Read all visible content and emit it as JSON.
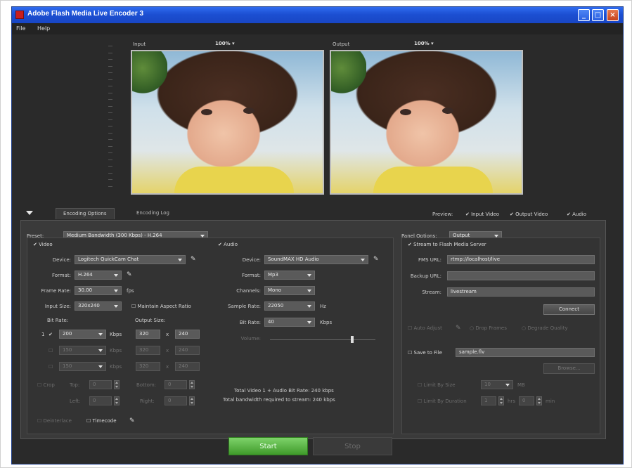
{
  "window": {
    "title": "Adobe Flash Media Live Encoder 3"
  },
  "menu": {
    "file": "File",
    "help": "Help"
  },
  "preview": {
    "input_label": "Input",
    "input_zoom": "100% ▾",
    "output_label": "Output",
    "output_zoom": "100% ▾"
  },
  "tabs": {
    "encoding_options": "Encoding Options",
    "encoding_log": "Encoding Log"
  },
  "preview_toggles": {
    "label": "Preview:",
    "input_video": "✔ Input Video",
    "output_video": "✔ Output Video",
    "audio": "✔ Audio"
  },
  "preset": {
    "label": "Preset:",
    "value": "Medium Bandwidth (300 Kbps) - H.264"
  },
  "video": {
    "header": "✔ Video",
    "device_label": "Device:",
    "device_value": "Logitech QuickCam Chat",
    "format_label": "Format:",
    "format_value": "H.264",
    "frame_rate_label": "Frame Rate:",
    "frame_rate_value": "30.00",
    "fps": "fps",
    "input_size_label": "Input Size:",
    "input_size_value": "320x240",
    "maintain_aspect": "☐ Maintain Aspect Ratio",
    "bit_rate_header": "Bit Rate:",
    "output_size_header": "Output Size:",
    "rows": [
      {
        "idx": "1",
        "check": "✔",
        "rate": "200",
        "unit": "Kbps",
        "w": "320",
        "h": "240",
        "dim": false
      },
      {
        "idx": "",
        "check": "☐",
        "rate": "150",
        "unit": "Kbps",
        "w": "320",
        "h": "240",
        "dim": true
      },
      {
        "idx": "",
        "check": "☐",
        "rate": "150",
        "unit": "Kbps",
        "w": "320",
        "h": "240",
        "dim": true
      }
    ],
    "x": "x",
    "crop": "☐ Crop",
    "top": "Top:",
    "bottom": "Bottom:",
    "left": "Left:",
    "right": "Right:",
    "crop_top": "0",
    "crop_bottom": "0",
    "crop_left": "0",
    "crop_right": "0",
    "deinterlace": "☐ Deinterlace",
    "timecode": "☐ Timecode"
  },
  "audio": {
    "header": "✔ Audio",
    "device_label": "Device:",
    "device_value": "SoundMAX HD Audio",
    "format_label": "Format:",
    "format_value": "Mp3",
    "channels_label": "Channels:",
    "channels_value": "Mono",
    "sample_rate_label": "Sample Rate:",
    "sample_rate_value": "22050",
    "hz": "Hz",
    "bit_rate_label": "Bit Rate:",
    "bit_rate_value": "40",
    "kbps": "Kbps",
    "volume_label": "Volume:",
    "volume_level": 0.78,
    "total_rate": "Total Video 1 + Audio Bit Rate:  240 kbps",
    "total_bandwidth": "Total bandwidth required to stream:  240 kbps"
  },
  "panel_options": {
    "label": "Panel Options:",
    "value": "Output"
  },
  "fms": {
    "stream_check": "✔ Stream to Flash Media Server",
    "url_label": "FMS URL:",
    "url_value": "rtmp://localhost/live",
    "backup_label": "Backup URL:",
    "backup_value": "",
    "stream_label": "Stream:",
    "stream_value": "livestream",
    "connect": "Connect",
    "auto_adjust": "☐ Auto Adjust",
    "drop_frames": "○ Drop Frames",
    "degrade_quality": "○ Degrade Quality",
    "save_to_file": "☐ Save to File",
    "file_value": "sample.flv",
    "browse": "Browse...",
    "limit_size": "☐ Limit By Size",
    "limit_size_value": "10",
    "mb": "MB",
    "limit_duration": "☐ Limit By Duration",
    "hrs_value": "1",
    "hrs": "hrs",
    "min_value": "0",
    "min": "min"
  },
  "actions": {
    "start": "Start",
    "stop": "Stop"
  },
  "colors": {
    "accent_green": "#4caf38",
    "title_blue": "#1c4fd2",
    "panel": "#3a3a3a"
  }
}
